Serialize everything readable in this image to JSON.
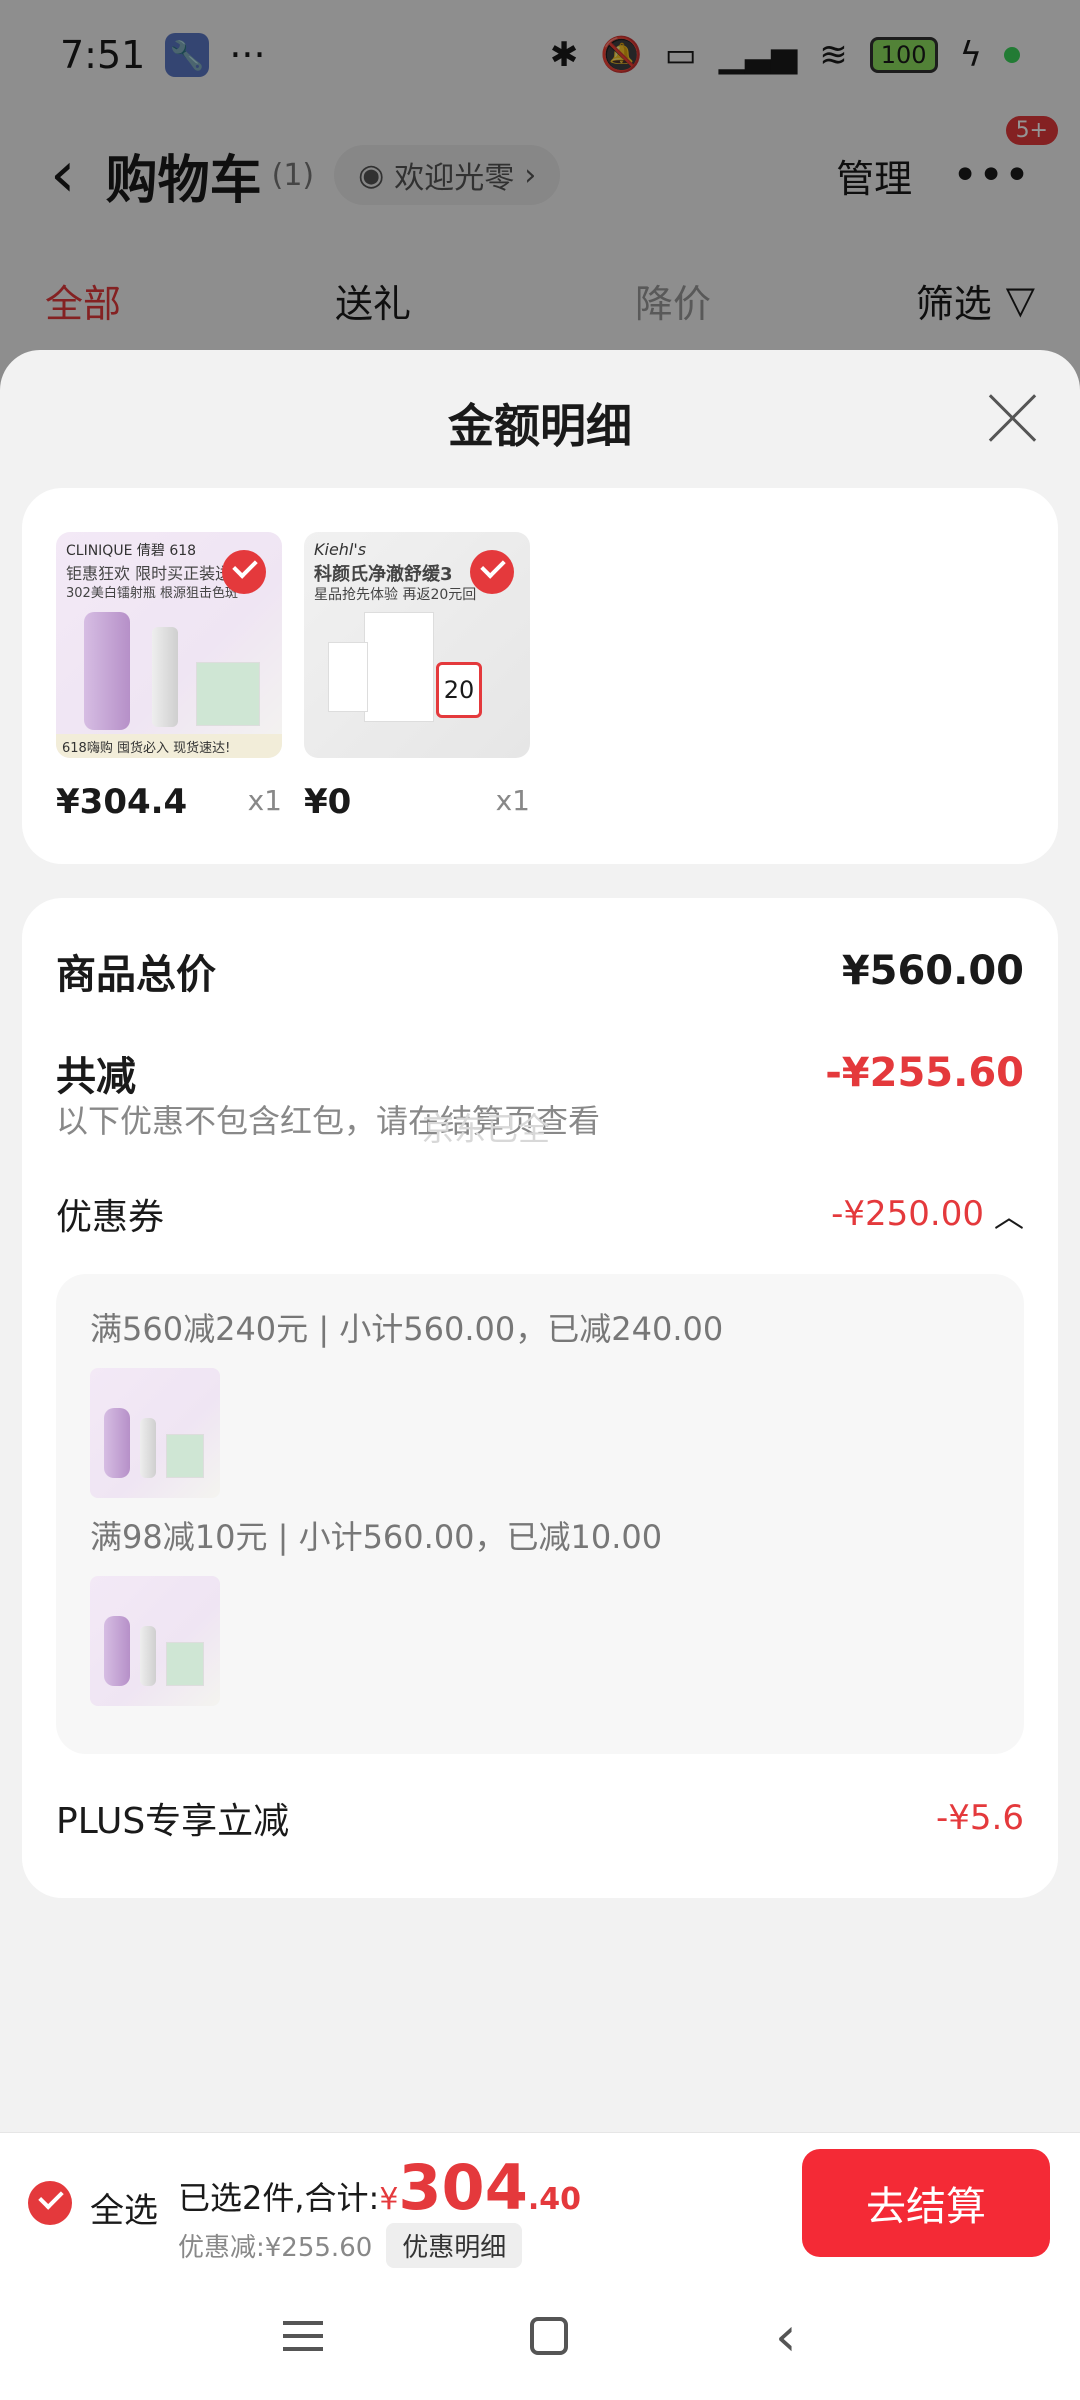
{
  "status_bar": {
    "time": "7:51",
    "battery": "100",
    "more": "···"
  },
  "header": {
    "back": "‹",
    "title": "购物车",
    "count": "(1)",
    "welcome": "欢迎光零",
    "manage": "管理",
    "more_badge": "5+"
  },
  "tabs": {
    "all": "全部",
    "gift": "送礼",
    "price_drop": "降价",
    "filter": "筛选"
  },
  "sheet": {
    "title": "金额明细"
  },
  "products": [
    {
      "brand_text": "CLINIQUE 倩碧 618",
      "line1": "钜惠狂欢 限时买正装送",
      "line2": "302美白镭射瓶 根源狙击色斑",
      "footer": "618嗨购   囤货必入 现货速达!",
      "price": "¥304.4",
      "qty": "x1"
    },
    {
      "brand_text": "Kiehl's",
      "line1": "科颜氏净澈舒缓3",
      "line2": "星品抢先体验 再返20元回",
      "badge": "20",
      "price": "¥0",
      "qty": "x1"
    }
  ],
  "details": {
    "total_label": "商品总价",
    "total_value": "¥560.00",
    "reduce_label": "共减",
    "reduce_value": "-¥255.60",
    "note": "以下优惠不包含红包，请在结算页查看",
    "watermark": "京东已全",
    "coupon_label": "优惠券",
    "coupon_value": "-¥250.00",
    "coupon_lines": [
      "满560减240元 | 小计560.00，已减240.00",
      "满98减10元 | 小计560.00，已减10.00"
    ],
    "plus_label": "PLUS专享立减",
    "plus_value": "-¥5.6"
  },
  "bottom_bar": {
    "select_all": "全选",
    "selected_text": "已选2件,合计:",
    "currency": "¥",
    "total_int": "304",
    "total_dec": ".40",
    "discount": "优惠减:¥255.60",
    "detail_button": "优惠明细",
    "checkout": "去结算"
  },
  "colors": {
    "accent": "#e4393c",
    "checkout": "#f42a36"
  }
}
